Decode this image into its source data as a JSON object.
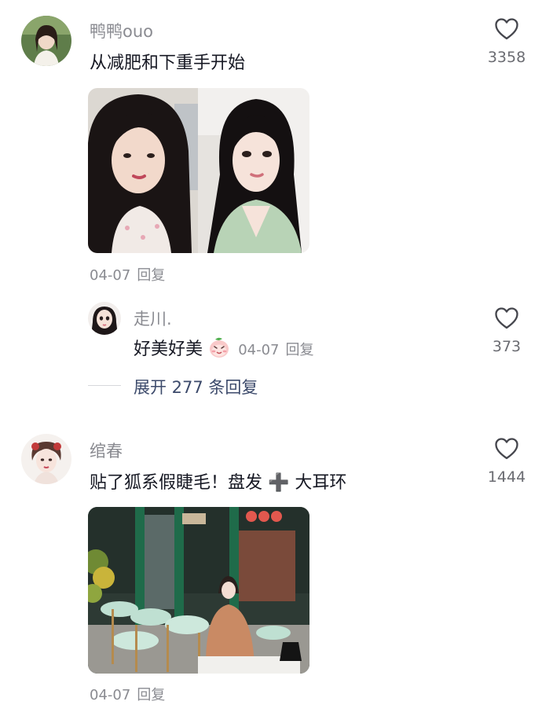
{
  "comments": [
    {
      "username": "鸭鸭ouo",
      "text": "从减肥和下重手开始",
      "likes": "3358",
      "date": "04-07",
      "reply_label": "回复",
      "icons": {
        "like": "heart-outline-icon"
      }
    },
    {
      "username": "绾春",
      "text": "贴了狐系假睫毛！盘发 ➕ 大耳环",
      "likes": "1444",
      "date": "04-07",
      "reply_label": "回复",
      "icons": {
        "like": "heart-outline-icon"
      }
    }
  ],
  "reply": {
    "username": "走川.",
    "text": "好美好美",
    "emoji": "peach-face-emoji",
    "date": "04-07",
    "reply_label": "回复",
    "likes": "373"
  },
  "expand": {
    "label": "展开 277 条回复"
  },
  "colors": {
    "secondary_text": "#8a8b91",
    "primary_text": "#161823",
    "expand_link": "#3c4a6b"
  }
}
